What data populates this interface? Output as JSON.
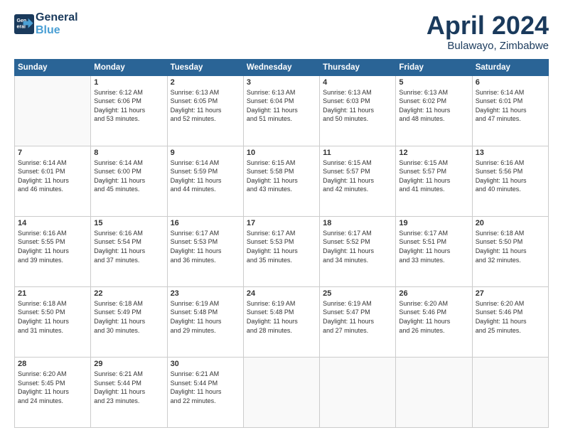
{
  "header": {
    "logo_line1": "General",
    "logo_line2": "Blue",
    "month": "April 2024",
    "location": "Bulawayo, Zimbabwe"
  },
  "weekdays": [
    "Sunday",
    "Monday",
    "Tuesday",
    "Wednesday",
    "Thursday",
    "Friday",
    "Saturday"
  ],
  "weeks": [
    [
      {
        "day": "",
        "info": ""
      },
      {
        "day": "1",
        "info": "Sunrise: 6:12 AM\nSunset: 6:06 PM\nDaylight: 11 hours\nand 53 minutes."
      },
      {
        "day": "2",
        "info": "Sunrise: 6:13 AM\nSunset: 6:05 PM\nDaylight: 11 hours\nand 52 minutes."
      },
      {
        "day": "3",
        "info": "Sunrise: 6:13 AM\nSunset: 6:04 PM\nDaylight: 11 hours\nand 51 minutes."
      },
      {
        "day": "4",
        "info": "Sunrise: 6:13 AM\nSunset: 6:03 PM\nDaylight: 11 hours\nand 50 minutes."
      },
      {
        "day": "5",
        "info": "Sunrise: 6:13 AM\nSunset: 6:02 PM\nDaylight: 11 hours\nand 48 minutes."
      },
      {
        "day": "6",
        "info": "Sunrise: 6:14 AM\nSunset: 6:01 PM\nDaylight: 11 hours\nand 47 minutes."
      }
    ],
    [
      {
        "day": "7",
        "info": "Sunrise: 6:14 AM\nSunset: 6:01 PM\nDaylight: 11 hours\nand 46 minutes."
      },
      {
        "day": "8",
        "info": "Sunrise: 6:14 AM\nSunset: 6:00 PM\nDaylight: 11 hours\nand 45 minutes."
      },
      {
        "day": "9",
        "info": "Sunrise: 6:14 AM\nSunset: 5:59 PM\nDaylight: 11 hours\nand 44 minutes."
      },
      {
        "day": "10",
        "info": "Sunrise: 6:15 AM\nSunset: 5:58 PM\nDaylight: 11 hours\nand 43 minutes."
      },
      {
        "day": "11",
        "info": "Sunrise: 6:15 AM\nSunset: 5:57 PM\nDaylight: 11 hours\nand 42 minutes."
      },
      {
        "day": "12",
        "info": "Sunrise: 6:15 AM\nSunset: 5:57 PM\nDaylight: 11 hours\nand 41 minutes."
      },
      {
        "day": "13",
        "info": "Sunrise: 6:16 AM\nSunset: 5:56 PM\nDaylight: 11 hours\nand 40 minutes."
      }
    ],
    [
      {
        "day": "14",
        "info": "Sunrise: 6:16 AM\nSunset: 5:55 PM\nDaylight: 11 hours\nand 39 minutes."
      },
      {
        "day": "15",
        "info": "Sunrise: 6:16 AM\nSunset: 5:54 PM\nDaylight: 11 hours\nand 37 minutes."
      },
      {
        "day": "16",
        "info": "Sunrise: 6:17 AM\nSunset: 5:53 PM\nDaylight: 11 hours\nand 36 minutes."
      },
      {
        "day": "17",
        "info": "Sunrise: 6:17 AM\nSunset: 5:53 PM\nDaylight: 11 hours\nand 35 minutes."
      },
      {
        "day": "18",
        "info": "Sunrise: 6:17 AM\nSunset: 5:52 PM\nDaylight: 11 hours\nand 34 minutes."
      },
      {
        "day": "19",
        "info": "Sunrise: 6:17 AM\nSunset: 5:51 PM\nDaylight: 11 hours\nand 33 minutes."
      },
      {
        "day": "20",
        "info": "Sunrise: 6:18 AM\nSunset: 5:50 PM\nDaylight: 11 hours\nand 32 minutes."
      }
    ],
    [
      {
        "day": "21",
        "info": "Sunrise: 6:18 AM\nSunset: 5:50 PM\nDaylight: 11 hours\nand 31 minutes."
      },
      {
        "day": "22",
        "info": "Sunrise: 6:18 AM\nSunset: 5:49 PM\nDaylight: 11 hours\nand 30 minutes."
      },
      {
        "day": "23",
        "info": "Sunrise: 6:19 AM\nSunset: 5:48 PM\nDaylight: 11 hours\nand 29 minutes."
      },
      {
        "day": "24",
        "info": "Sunrise: 6:19 AM\nSunset: 5:48 PM\nDaylight: 11 hours\nand 28 minutes."
      },
      {
        "day": "25",
        "info": "Sunrise: 6:19 AM\nSunset: 5:47 PM\nDaylight: 11 hours\nand 27 minutes."
      },
      {
        "day": "26",
        "info": "Sunrise: 6:20 AM\nSunset: 5:46 PM\nDaylight: 11 hours\nand 26 minutes."
      },
      {
        "day": "27",
        "info": "Sunrise: 6:20 AM\nSunset: 5:46 PM\nDaylight: 11 hours\nand 25 minutes."
      }
    ],
    [
      {
        "day": "28",
        "info": "Sunrise: 6:20 AM\nSunset: 5:45 PM\nDaylight: 11 hours\nand 24 minutes."
      },
      {
        "day": "29",
        "info": "Sunrise: 6:21 AM\nSunset: 5:44 PM\nDaylight: 11 hours\nand 23 minutes."
      },
      {
        "day": "30",
        "info": "Sunrise: 6:21 AM\nSunset: 5:44 PM\nDaylight: 11 hours\nand 22 minutes."
      },
      {
        "day": "",
        "info": ""
      },
      {
        "day": "",
        "info": ""
      },
      {
        "day": "",
        "info": ""
      },
      {
        "day": "",
        "info": ""
      }
    ]
  ]
}
